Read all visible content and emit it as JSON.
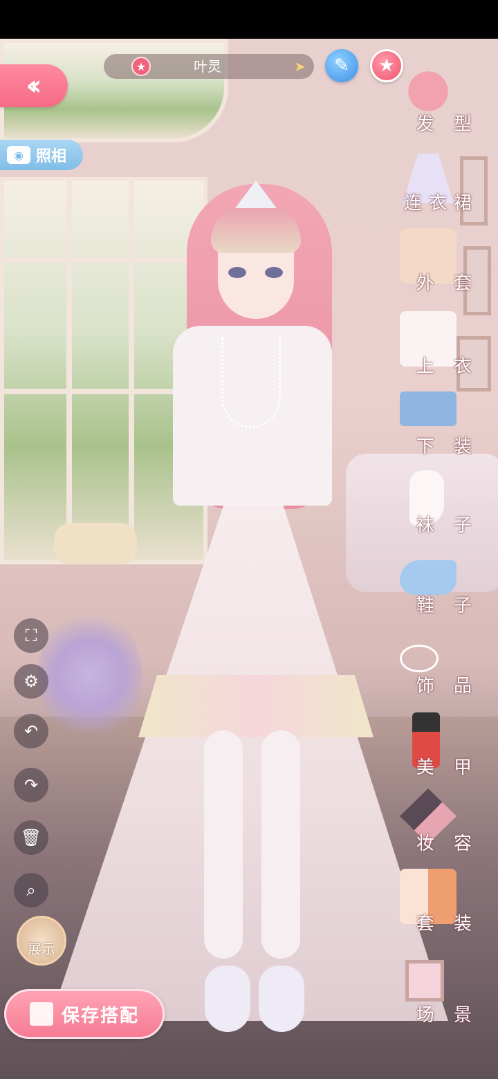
{
  "header": {
    "character_name": "叶灵",
    "back_icon": "double-chevron-left-icon",
    "pen_icon": "pen-icon",
    "favorite_icon": "star-icon"
  },
  "camera_button": {
    "label": "照相",
    "icon": "camera-icon"
  },
  "categories": [
    {
      "label": "发 型",
      "icon": "hairstyle-icon"
    },
    {
      "label": "连衣裙",
      "icon": "dress-icon"
    },
    {
      "label": "外 套",
      "icon": "coat-icon"
    },
    {
      "label": "上 衣",
      "icon": "top-icon"
    },
    {
      "label": "下 装",
      "icon": "bottoms-icon"
    },
    {
      "label": "袜 子",
      "icon": "socks-icon"
    },
    {
      "label": "鞋 子",
      "icon": "shoes-icon"
    },
    {
      "label": "饰 品",
      "icon": "accessory-icon"
    },
    {
      "label": "美 甲",
      "icon": "nail-polish-icon"
    },
    {
      "label": "妆 容",
      "icon": "makeup-icon"
    },
    {
      "label": "套 装",
      "icon": "outfit-set-icon"
    },
    {
      "label": "场 景",
      "icon": "scene-icon"
    }
  ],
  "side_tools": [
    {
      "name": "fullscreen-icon"
    },
    {
      "name": "settings-icon"
    },
    {
      "name": "undo-icon"
    },
    {
      "name": "redo-icon"
    },
    {
      "name": "trash-icon"
    },
    {
      "name": "zoom-icon"
    }
  ],
  "show_button": {
    "label": "展示"
  },
  "save_button": {
    "label": "保存搭配"
  },
  "colors": {
    "accent_pink": "#f56b86",
    "camera_blue": "#7fbde8",
    "pen_blue": "#3c8fe6"
  }
}
